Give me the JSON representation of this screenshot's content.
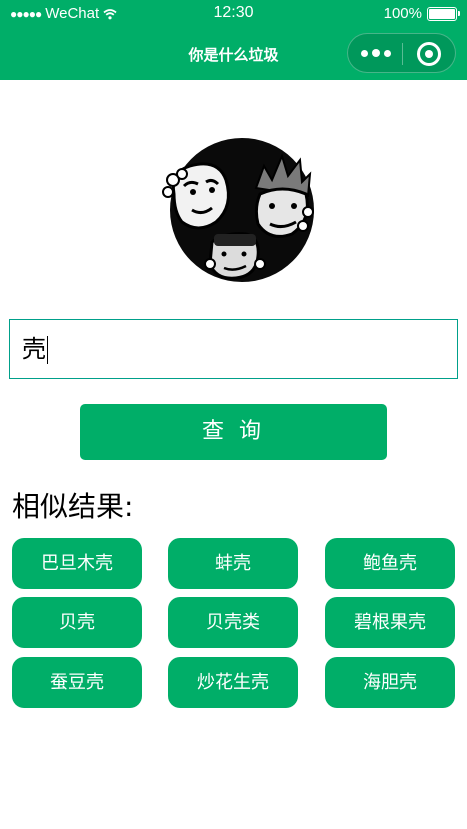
{
  "status_bar": {
    "carrier": "WeChat",
    "time": "12:30",
    "battery": "100%",
    "signal_icon": "signal-dots-icon",
    "wifi_icon": "wifi-icon",
    "battery_icon": "battery-icon"
  },
  "nav": {
    "title": "你是什么垃圾",
    "more_icon": "more-dots-icon",
    "close_icon": "target-circle-icon"
  },
  "logo": {
    "icon": "three-faces-meme-logo"
  },
  "search": {
    "value": "壳"
  },
  "query_button": {
    "label": "查 询"
  },
  "results": {
    "title": "相似结果:",
    "items": [
      "巴旦木壳",
      "蚌壳",
      "鲍鱼壳",
      "贝壳",
      "贝壳类",
      "碧根果壳",
      "蚕豆壳",
      "炒花生壳",
      "海胆壳"
    ]
  },
  "colors": {
    "brand": "#00ae68",
    "input_border": "#00a08a"
  }
}
